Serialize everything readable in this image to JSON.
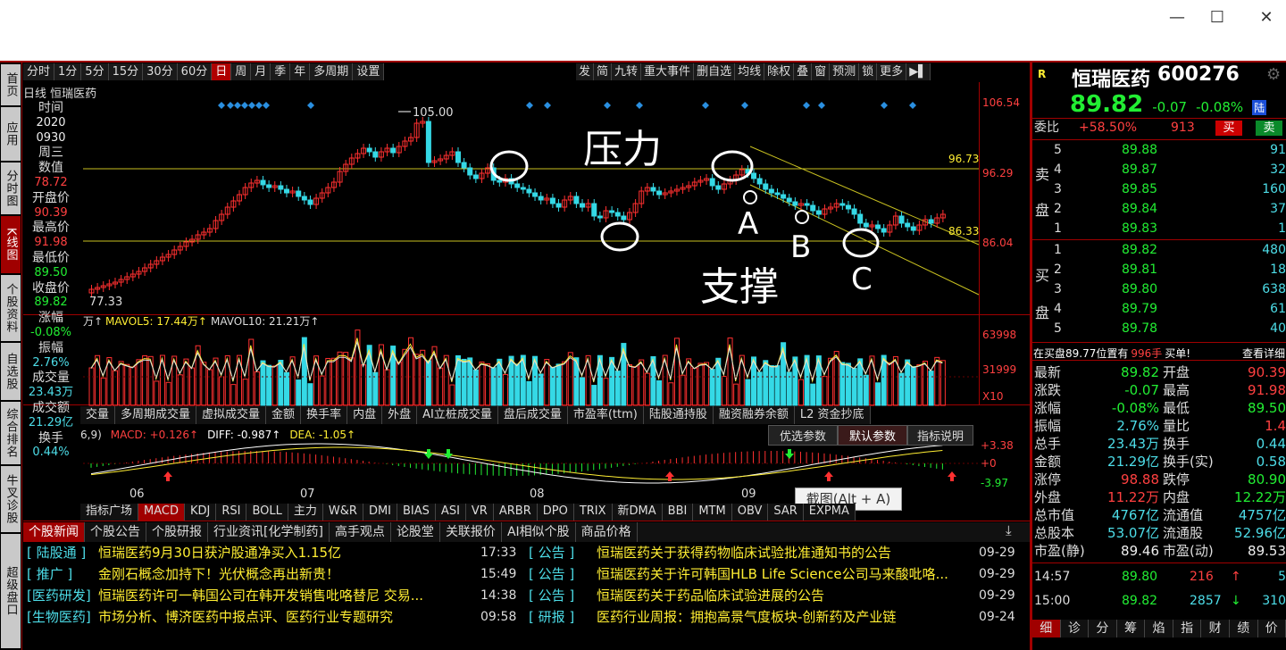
{
  "window": {
    "min": "—",
    "max": "☐",
    "close": "✕"
  },
  "left_tabs": [
    "首页",
    "应用",
    "分时图",
    "K线图",
    "个股资料",
    "自选股",
    "综合排名",
    "牛叉诊股",
    "超级盘口"
  ],
  "periods": [
    "分时",
    "1分",
    "5分",
    "15分",
    "30分",
    "60分",
    "日",
    "周",
    "月",
    "季",
    "年",
    "多周期",
    "设置"
  ],
  "selected_period": "日",
  "toolbar": [
    "发",
    "简",
    "九转",
    "重大事件",
    "删自选",
    "均线",
    "除权",
    "叠",
    "窗",
    "预测",
    "锁",
    "更多",
    "▶▌"
  ],
  "chart_header": "日线  恒瑞医药",
  "info": [
    {
      "label": "时间",
      "value": "2020",
      "color": "white"
    },
    {
      "label": "",
      "value": "0930",
      "color": "white"
    },
    {
      "label": "周三",
      "value": "",
      "color": "white"
    },
    {
      "label": "数值",
      "value": "78.72",
      "color": "red"
    },
    {
      "label": "开盘价",
      "value": "90.39",
      "color": "red"
    },
    {
      "label": "最高价",
      "value": "91.98",
      "color": "red"
    },
    {
      "label": "最低价",
      "value": "89.50",
      "color": "green"
    },
    {
      "label": "收盘价",
      "value": "89.82",
      "color": "green"
    },
    {
      "label": "涨幅",
      "value": "-0.08%",
      "color": "green"
    },
    {
      "label": "振幅",
      "value": "2.76%",
      "color": "cyan"
    },
    {
      "label": "成交量",
      "value": "23.43万",
      "color": "cyan"
    },
    {
      "label": "成交额",
      "value": "21.29亿",
      "color": "cyan"
    },
    {
      "label": "换手",
      "value": "0.44%",
      "color": "cyan"
    }
  ],
  "price_axis": [
    "106.54",
    "96.29",
    "86.04"
  ],
  "line_labels": {
    "high": "105.00",
    "low": "77.33",
    "upper": "96.73",
    "lower": "86.33"
  },
  "annotations": {
    "pressure": "压力",
    "support": "支撑",
    "a": "A",
    "b": "B",
    "c": "C"
  },
  "vol_header": {
    "unit": "万↑",
    "mavol5": "MAVOL5: 17.44万↑",
    "mavol10": "MAVOL10: 21.21万↑"
  },
  "vol_axis": [
    "63998",
    "31999",
    "X10"
  ],
  "ind_tabs": [
    "交量",
    "多周期成交量",
    "虚拟成交量",
    "金额",
    "换手率",
    "内盘",
    "外盘",
    "AI立桩成交量",
    "盘后成交量",
    "市盈率(ttm)",
    "陆股通持股",
    "融资融券余额",
    "L2 资金抄底"
  ],
  "macd_header": {
    "params": "6,9)",
    "macd": "MACD: +0.126↑",
    "diff": "DIFF: -0.987↑",
    "dea": "DEA: -1.05↑"
  },
  "macd_btns": [
    "优选参数",
    "默认参数",
    "指标说明"
  ],
  "macd_axis": [
    "+3.38",
    "+0",
    "-3.97"
  ],
  "months": [
    "06",
    "07",
    "08",
    "09"
  ],
  "tooltip": "截图(Alt + A)",
  "bottom_ind": [
    "指标广场",
    "MACD",
    "KDJ",
    "RSI",
    "BOLL",
    "主力",
    "W&R",
    "DMI",
    "BIAS",
    "ASI",
    "VR",
    "ARBR",
    "DPO",
    "TRIX",
    "新DMA",
    "BBI",
    "MTM",
    "OBV",
    "SAR",
    "EXPMA"
  ],
  "news_tabs": [
    "个股新闻",
    "个股公告",
    "个股研报",
    "行业资讯[化学制药]",
    "高手观点",
    "论股堂",
    "关联报价",
    "AI相似个股",
    "商品价格"
  ],
  "news": [
    {
      "tag": "[  陆股通  ]",
      "title": "恒瑞医药9月30日获沪股通净买入1.15亿",
      "time": "17:33",
      "tag2": "[    公告    ]",
      "title2": "恒瑞医药关于获得药物临床试验批准通知书的公告",
      "time2": "09-29"
    },
    {
      "tag": "[   推广   ]",
      "title": "金刚石概念加持下！光伏概念再出新贵！",
      "time": "15:49",
      "tag2": "[    公告    ]",
      "title2": "恒瑞医药关于许可韩国HLB Life Science公司马来酸吡咯...",
      "time2": "09-29"
    },
    {
      "tag": "[医药研发]",
      "title": "恒瑞医药许可一韩国公司在韩开发销售吡咯替尼 交易...",
      "time": "14:38",
      "tag2": "[    公告    ]",
      "title2": "恒瑞医药关于药品临床试验进展的公告",
      "time2": "09-29"
    },
    {
      "tag": "[生物医药]",
      "title": "市场分析、博济医药中报点评、医药行业专题研究",
      "time": "09:58",
      "tag2": "[    研报    ]",
      "title2": "医药行业周报：拥抱高景气度板块-创新药及产业链",
      "time2": "09-24"
    }
  ],
  "stock": {
    "name": "恒瑞医药",
    "code": "600276",
    "price": "89.82",
    "change": "-0.07",
    "pct": "-0.08%",
    "tag": "陆",
    "gear": "⚙"
  },
  "weibi": {
    "label": "委比",
    "value": "+58.50%",
    "diff": "913",
    "buy": "买",
    "sell": "卖"
  },
  "asks": [
    {
      "lvl": "5",
      "price": "89.88",
      "vol": "91"
    },
    {
      "lvl": "4",
      "price": "89.87",
      "vol": "32"
    },
    {
      "lvl": "3",
      "price": "89.85",
      "vol": "160"
    },
    {
      "lvl": "2",
      "price": "89.84",
      "vol": "37"
    },
    {
      "lvl": "1",
      "price": "89.83",
      "vol": "1"
    }
  ],
  "bids": [
    {
      "lvl": "1",
      "price": "89.82",
      "vol": "480"
    },
    {
      "lvl": "2",
      "price": "89.81",
      "vol": "18"
    },
    {
      "lvl": "3",
      "price": "89.80",
      "vol": "638"
    },
    {
      "lvl": "4",
      "price": "89.79",
      "vol": "61"
    },
    {
      "lvl": "5",
      "price": "89.78",
      "vol": "40"
    }
  ],
  "ask_label": [
    "卖",
    "盘"
  ],
  "bid_label": [
    "买",
    "盘"
  ],
  "inline": {
    "text": "在买盘89.77位置有",
    "qty": "996手",
    "suffix": "买单!",
    "detail": "查看详细"
  },
  "stats": [
    {
      "l1": "最新",
      "v1": "89.82",
      "c1": "green",
      "l2": "开盘",
      "v2": "90.39",
      "c2": "red"
    },
    {
      "l1": "涨跌",
      "v1": "-0.07",
      "c1": "green",
      "l2": "最高",
      "v2": "91.98",
      "c2": "red"
    },
    {
      "l1": "涨幅",
      "v1": "-0.08%",
      "c1": "green",
      "l2": "最低",
      "v2": "89.50",
      "c2": "green"
    },
    {
      "l1": "振幅",
      "v1": "2.76%",
      "c1": "cyan",
      "l2": "量比",
      "v2": "1.4",
      "c2": "red"
    },
    {
      "l1": "总手",
      "v1": "23.43万",
      "c1": "cyan",
      "l2": "换手",
      "v2": "0.44",
      "c2": "cyan"
    },
    {
      "l1": "金额",
      "v1": "21.29亿",
      "c1": "cyan",
      "l2": "换手(实)",
      "v2": "0.58",
      "c2": "cyan"
    },
    {
      "l1": "涨停",
      "v1": "98.88",
      "c1": "red",
      "l2": "跌停",
      "v2": "80.90",
      "c2": "green"
    },
    {
      "l1": "外盘",
      "v1": "11.22万",
      "c1": "red",
      "l2": "内盘",
      "v2": "12.22万",
      "c2": "green"
    },
    {
      "l1": "总市值",
      "v1": "4767亿",
      "c1": "cyan",
      "l2": "流通值",
      "v2": "4757亿",
      "c2": "cyan"
    },
    {
      "l1": "总股本",
      "v1": "53.07亿",
      "c1": "cyan",
      "l2": "流通股",
      "v2": "52.96亿",
      "c2": "cyan"
    },
    {
      "l1": "市盈(静)",
      "v1": "89.46",
      "c1": "white",
      "l2": "市盈(动)",
      "v2": "89.53",
      "c2": "white"
    }
  ],
  "ticks": [
    {
      "time": "14:57",
      "price": "89.80",
      "vol": "216",
      "dir": "↑",
      "n": "5"
    },
    {
      "time": "15:00",
      "price": "89.82",
      "vol": "2857",
      "dir": "↓",
      "n": "310"
    }
  ],
  "quote_tabs": [
    "细",
    "诊",
    "分",
    "筹",
    "焰",
    "指",
    "财",
    "绩",
    "价"
  ]
}
